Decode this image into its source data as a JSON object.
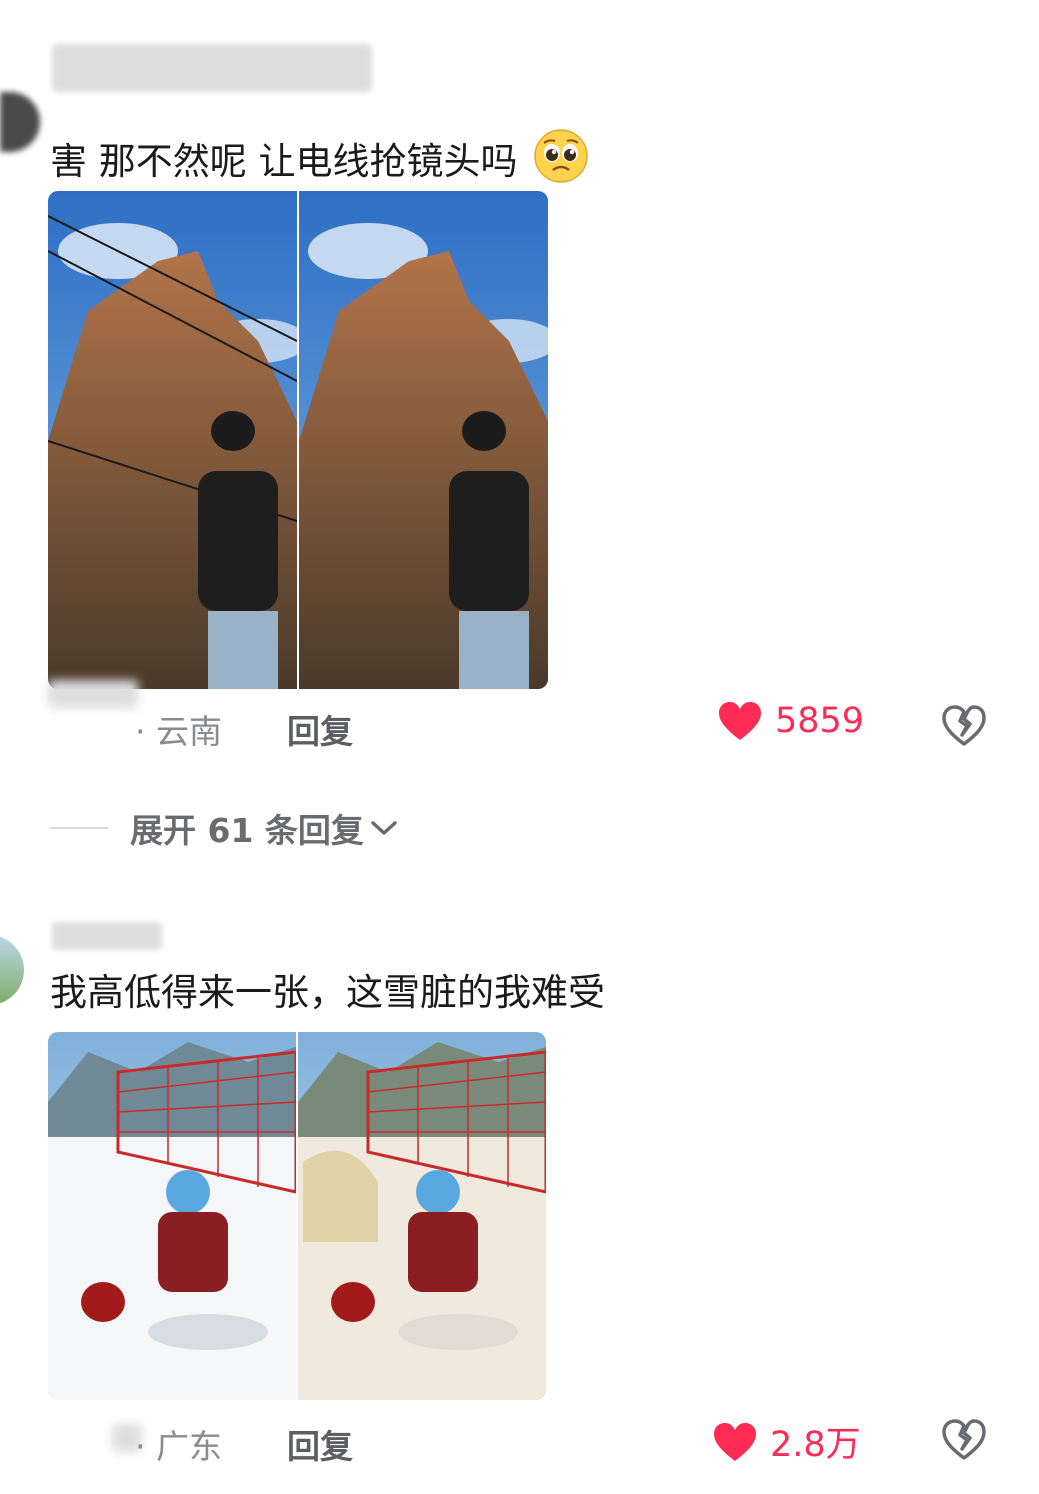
{
  "comments": [
    {
      "text": "害 那不然呢 让电线抢镜头吗",
      "emoji": "pleading-face-icon",
      "location": "· 云南",
      "reply_label": "回复",
      "like_count": "5859"
    },
    {
      "text": "我高低得来一张，这雪脏的我难受",
      "location": "· 广东",
      "reply_label": "回复",
      "like_count": "2.8万"
    }
  ],
  "expand_replies_label": "展开 61 条回复",
  "colors": {
    "like": "#fe2c55",
    "meta": "#8a8b91",
    "text": "#1b1b1f"
  }
}
